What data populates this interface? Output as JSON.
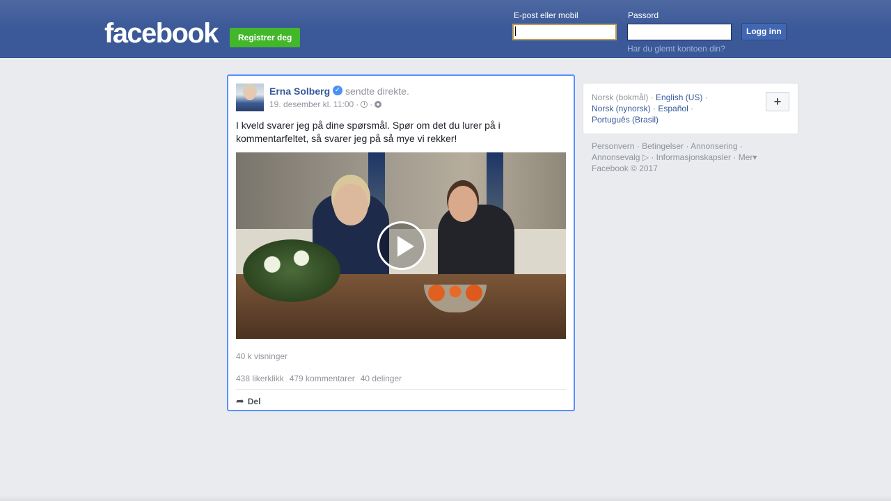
{
  "header": {
    "logo": "facebook",
    "register_label": "Registrer deg",
    "email_label": "E-post eller mobil",
    "password_label": "Passord",
    "login_label": "Logg inn",
    "forgot_label": "Har du glemt kontoen din?",
    "email_value": "",
    "password_value": ""
  },
  "post": {
    "author": "Erna Solberg",
    "action": "sendte direkte.",
    "date": "19. desember kl. 11:00",
    "separator": "·",
    "text": "I kveld svarer jeg på dine spørsmål. Spør om det du lurer på i kommentarfeltet, så svarer jeg på så mye vi rekker!",
    "views": "40 k visninger",
    "likes": "438 likerklikk",
    "comments": "479 kommentarer",
    "shares": "40 delinger",
    "share_label": "Del"
  },
  "languages": {
    "current": "Norsk (bokmål)",
    "items": [
      "English (US)",
      "Norsk (nynorsk)",
      "Español",
      "Português (Brasil)"
    ],
    "sep": "·"
  },
  "footer": {
    "links": [
      "Personvern",
      "Betingelser",
      "Annonsering",
      "Annonsevalg",
      "Informasjonskapsler",
      "Mer"
    ],
    "copyright": "Facebook © 2017"
  },
  "colors": {
    "brand_blue": "#3b5998",
    "link_blue": "#365899",
    "register_green": "#42b72a",
    "focus_border": "#5890ff"
  }
}
